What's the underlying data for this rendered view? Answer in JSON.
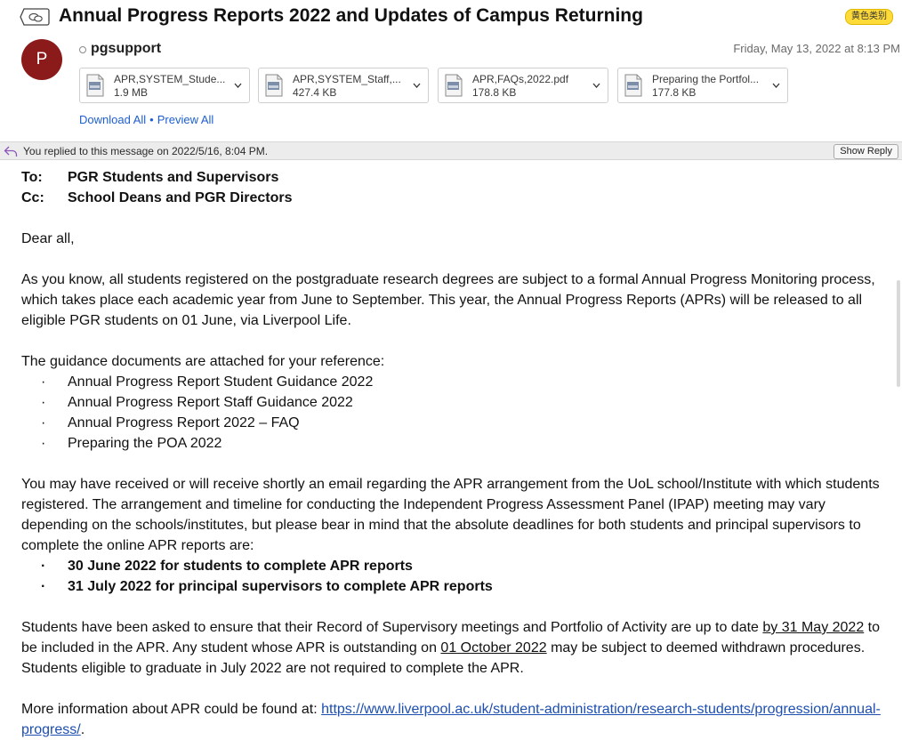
{
  "email": {
    "subject": "Annual Progress Reports 2022 and Updates of Campus Returning",
    "label_tag": "黄色类别",
    "avatar_letter": "P",
    "sender": "pgsupport",
    "date": "Friday, May 13, 2022 at 8:13 PM"
  },
  "attachments": [
    {
      "name": "APR,SYSTEM_Stude...",
      "size": "1.9 MB",
      "icon": "pdf-file-icon"
    },
    {
      "name": "APR,SYSTEM_Staff,...",
      "size": "427.4 KB",
      "icon": "pdf-file-icon"
    },
    {
      "name": "APR,FAQs,2022.pdf",
      "size": "178.8 KB",
      "icon": "pdf-file-icon"
    },
    {
      "name": "Preparing the Portfol...",
      "size": "177.8 KB",
      "icon": "pdf-file-icon"
    }
  ],
  "actions": {
    "download_all": "Download All",
    "separator": "•",
    "preview_all": "Preview All"
  },
  "replied": {
    "text": "You replied to this message on 2022/5/16, 8:04 PM.",
    "show_reply": "Show Reply"
  },
  "body": {
    "to_label": "To:",
    "to_value": "PGR Students and Supervisors",
    "cc_label": "Cc:",
    "cc_value": "School Deans and PGR Directors",
    "greeting": "Dear all,",
    "para1": "As you know, all students registered on the postgraduate research degrees are subject to a formal Annual Progress Monitoring process, which takes place each academic year from June to September. This year, the Annual Progress Reports (APRs) will be released to all eligible PGR students on 01 June, via Liverpool Life.",
    "guidance_intro": "The guidance documents are attached for your reference:",
    "bullet_char": "·",
    "guidance_items": [
      "Annual Progress Report Student Guidance 2022",
      "Annual Progress Report Staff Guidance 2022",
      "Annual Progress Report 2022 – FAQ",
      "Preparing the POA 2022"
    ],
    "para2": "You may have received or will receive shortly an email regarding the APR arrangement from the UoL school/Institute with which students registered. The arrangement and timeline for conducting the Independent Progress Assessment Panel (IPAP) meeting may vary depending on the schools/institutes, but please bear in mind that the absolute deadlines for both students and principal supervisors to complete the online APR reports are:",
    "deadlines": [
      "30 June 2022 for students to complete APR reports",
      "31 July 2022 for principal supervisors to complete APR reports"
    ],
    "para3_a": "Students have been asked to ensure that their Record of Supervisory meetings and Portfolio of Activity are up to date ",
    "para3_u1": "by 31 May 2022",
    "para3_b": " to be included in the APR. Any student whose APR is outstanding on ",
    "para3_u2": "01 October 2022",
    "para3_c": " may be subject to deemed withdrawn procedures. Students eligible to graduate in July 2022 are not required to complete the APR.",
    "para4_a": "More information about APR could be found at: ",
    "para4_link": "https://www.liverpool.ac.uk/student-administration/research-students/progression/annual-progress/",
    "para4_end": "."
  },
  "colors": {
    "avatar": "#8b1b1b",
    "link": "#1d5fd0",
    "label_tag": "#ffdb3a"
  }
}
